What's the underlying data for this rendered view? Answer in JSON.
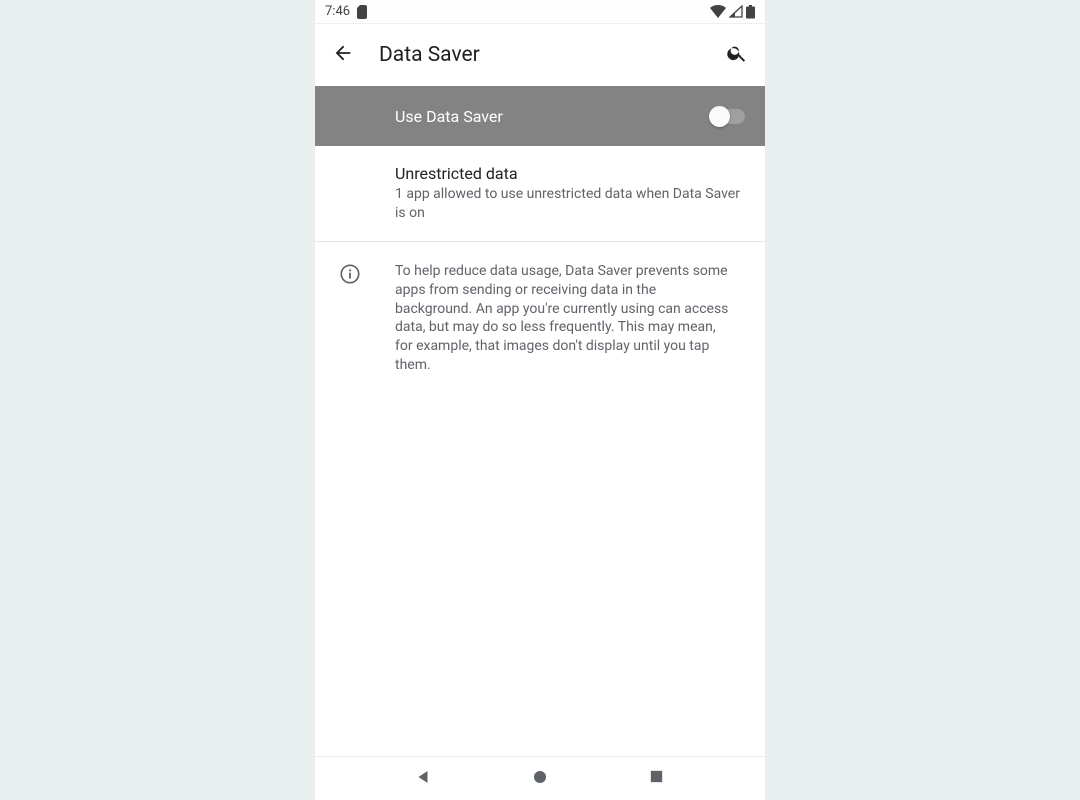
{
  "statusbar": {
    "time": "7:46"
  },
  "appbar": {
    "title": "Data Saver"
  },
  "toggle": {
    "label": "Use Data Saver",
    "value": false
  },
  "unrestricted": {
    "title": "Unrestricted data",
    "subtitle": "1 app allowed to use unrestricted data when Data Saver is on"
  },
  "info": {
    "text": "To help reduce data usage, Data Saver prevents some apps from sending or receiving data in the background. An app you're currently using can access data, but may do so less frequently. This may mean, for example, that images don't display until you tap them."
  }
}
